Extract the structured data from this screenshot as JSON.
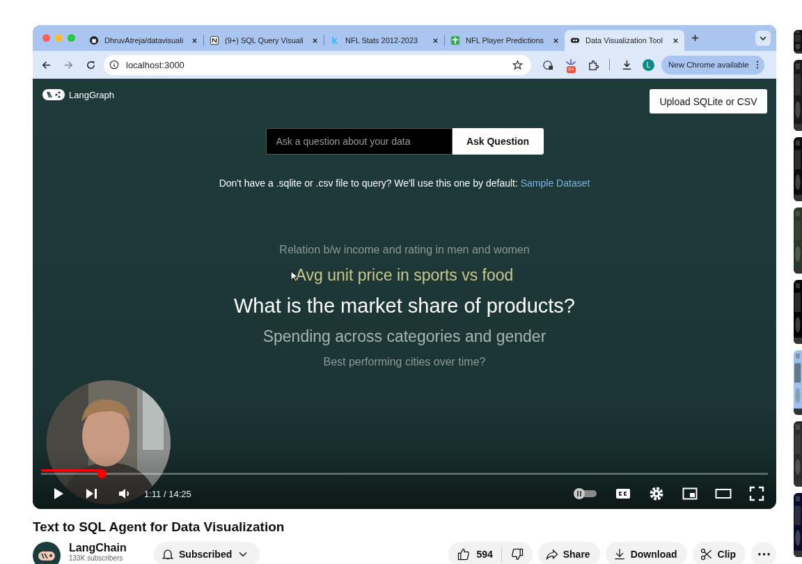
{
  "browser": {
    "tabs": [
      {
        "title": "DhruvAtreja/datavisuali",
        "selected": false
      },
      {
        "title": "(9+) SQL Query Visuali",
        "selected": false
      },
      {
        "title": "NFL Stats 2012-2023",
        "selected": false
      },
      {
        "title": "NFL Player Predictions",
        "selected": false
      },
      {
        "title": "Data Visualization Tool",
        "selected": true
      }
    ],
    "address": "localhost:3000",
    "extension_badge": "9+",
    "profile": "L",
    "update_button": "New Chrome available"
  },
  "app": {
    "logo": "LangGraph",
    "upload_button": "Upload SQLite or CSV",
    "question_field": {
      "placeholder": "Ask a question about your data"
    },
    "ask_button": "Ask Question",
    "note": "Don't have a .sqlite or .csv file to query? We'll use this one by default:",
    "note_link": "Sample Dataset",
    "suggestions": [
      {
        "text": "Relation b/w income and rating in men and women",
        "kind": "far",
        "hovered": false
      },
      {
        "text": "Avg unit price in sports vs food",
        "kind": "near",
        "hovered": true
      },
      {
        "text": "What is the market share of products?",
        "kind": "center",
        "hovered": false
      },
      {
        "text": "Spending across categories and gender",
        "kind": "near",
        "hovered": false
      },
      {
        "text": "Best performing cities over time?",
        "kind": "far",
        "hovered": false
      }
    ]
  },
  "player": {
    "progress": {
      "level": 0.083
    },
    "time": "1:11 / 14:25"
  },
  "video_title": "Text to SQL Agent for Data Visualization",
  "channel": {
    "name": "LangChain",
    "subscribers": "133K subscribers",
    "subscribe_button": "Subscribed"
  },
  "actions": {
    "likes": "594",
    "share": "Share",
    "download": "Download",
    "clip": "Clip"
  }
}
